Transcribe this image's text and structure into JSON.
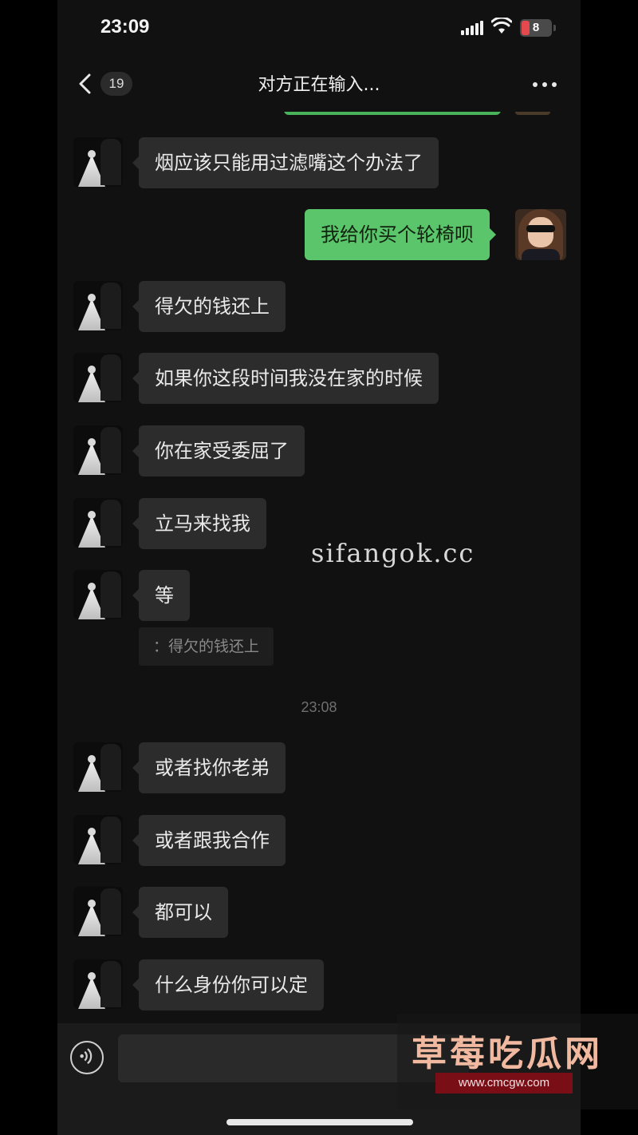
{
  "status_bar": {
    "time": "23:09",
    "battery": "8"
  },
  "nav": {
    "unread_count": "19",
    "title": "对方正在输入..."
  },
  "messages": [
    {
      "text": "烟应该只能用过滤嘴这个办法了"
    },
    {
      "text": "我给你买个轮椅呗"
    },
    {
      "text": "得欠的钱还上"
    },
    {
      "text": "如果你这段时间我没在家的时候"
    },
    {
      "text": "你在家受委屈了"
    },
    {
      "text": "立马来找我"
    },
    {
      "text": "等"
    },
    {
      "text": "或者找你老弟"
    },
    {
      "text": "或者跟我合作"
    },
    {
      "text": "都可以"
    },
    {
      "text": "什么身份你可以定"
    }
  ],
  "quote": {
    "text": "：得欠的钱还上"
  },
  "timestamp": "23:08",
  "watermark": {
    "text": "sifangok.cc"
  },
  "brand": {
    "name": "草莓吃瓜网",
    "url": "www.cmcgw.com"
  },
  "colors": {
    "outgoing_bubble": "#5ac56a",
    "incoming_bubble": "#2c2c2c",
    "background": "#111111",
    "brand_url_bg": "#7a0e16"
  },
  "icons": {
    "back": "chevron-left-icon",
    "more": "more-dots-icon",
    "voice": "voice-icon",
    "signal": "signal-icon",
    "wifi": "wifi-icon",
    "battery": "battery-icon"
  }
}
